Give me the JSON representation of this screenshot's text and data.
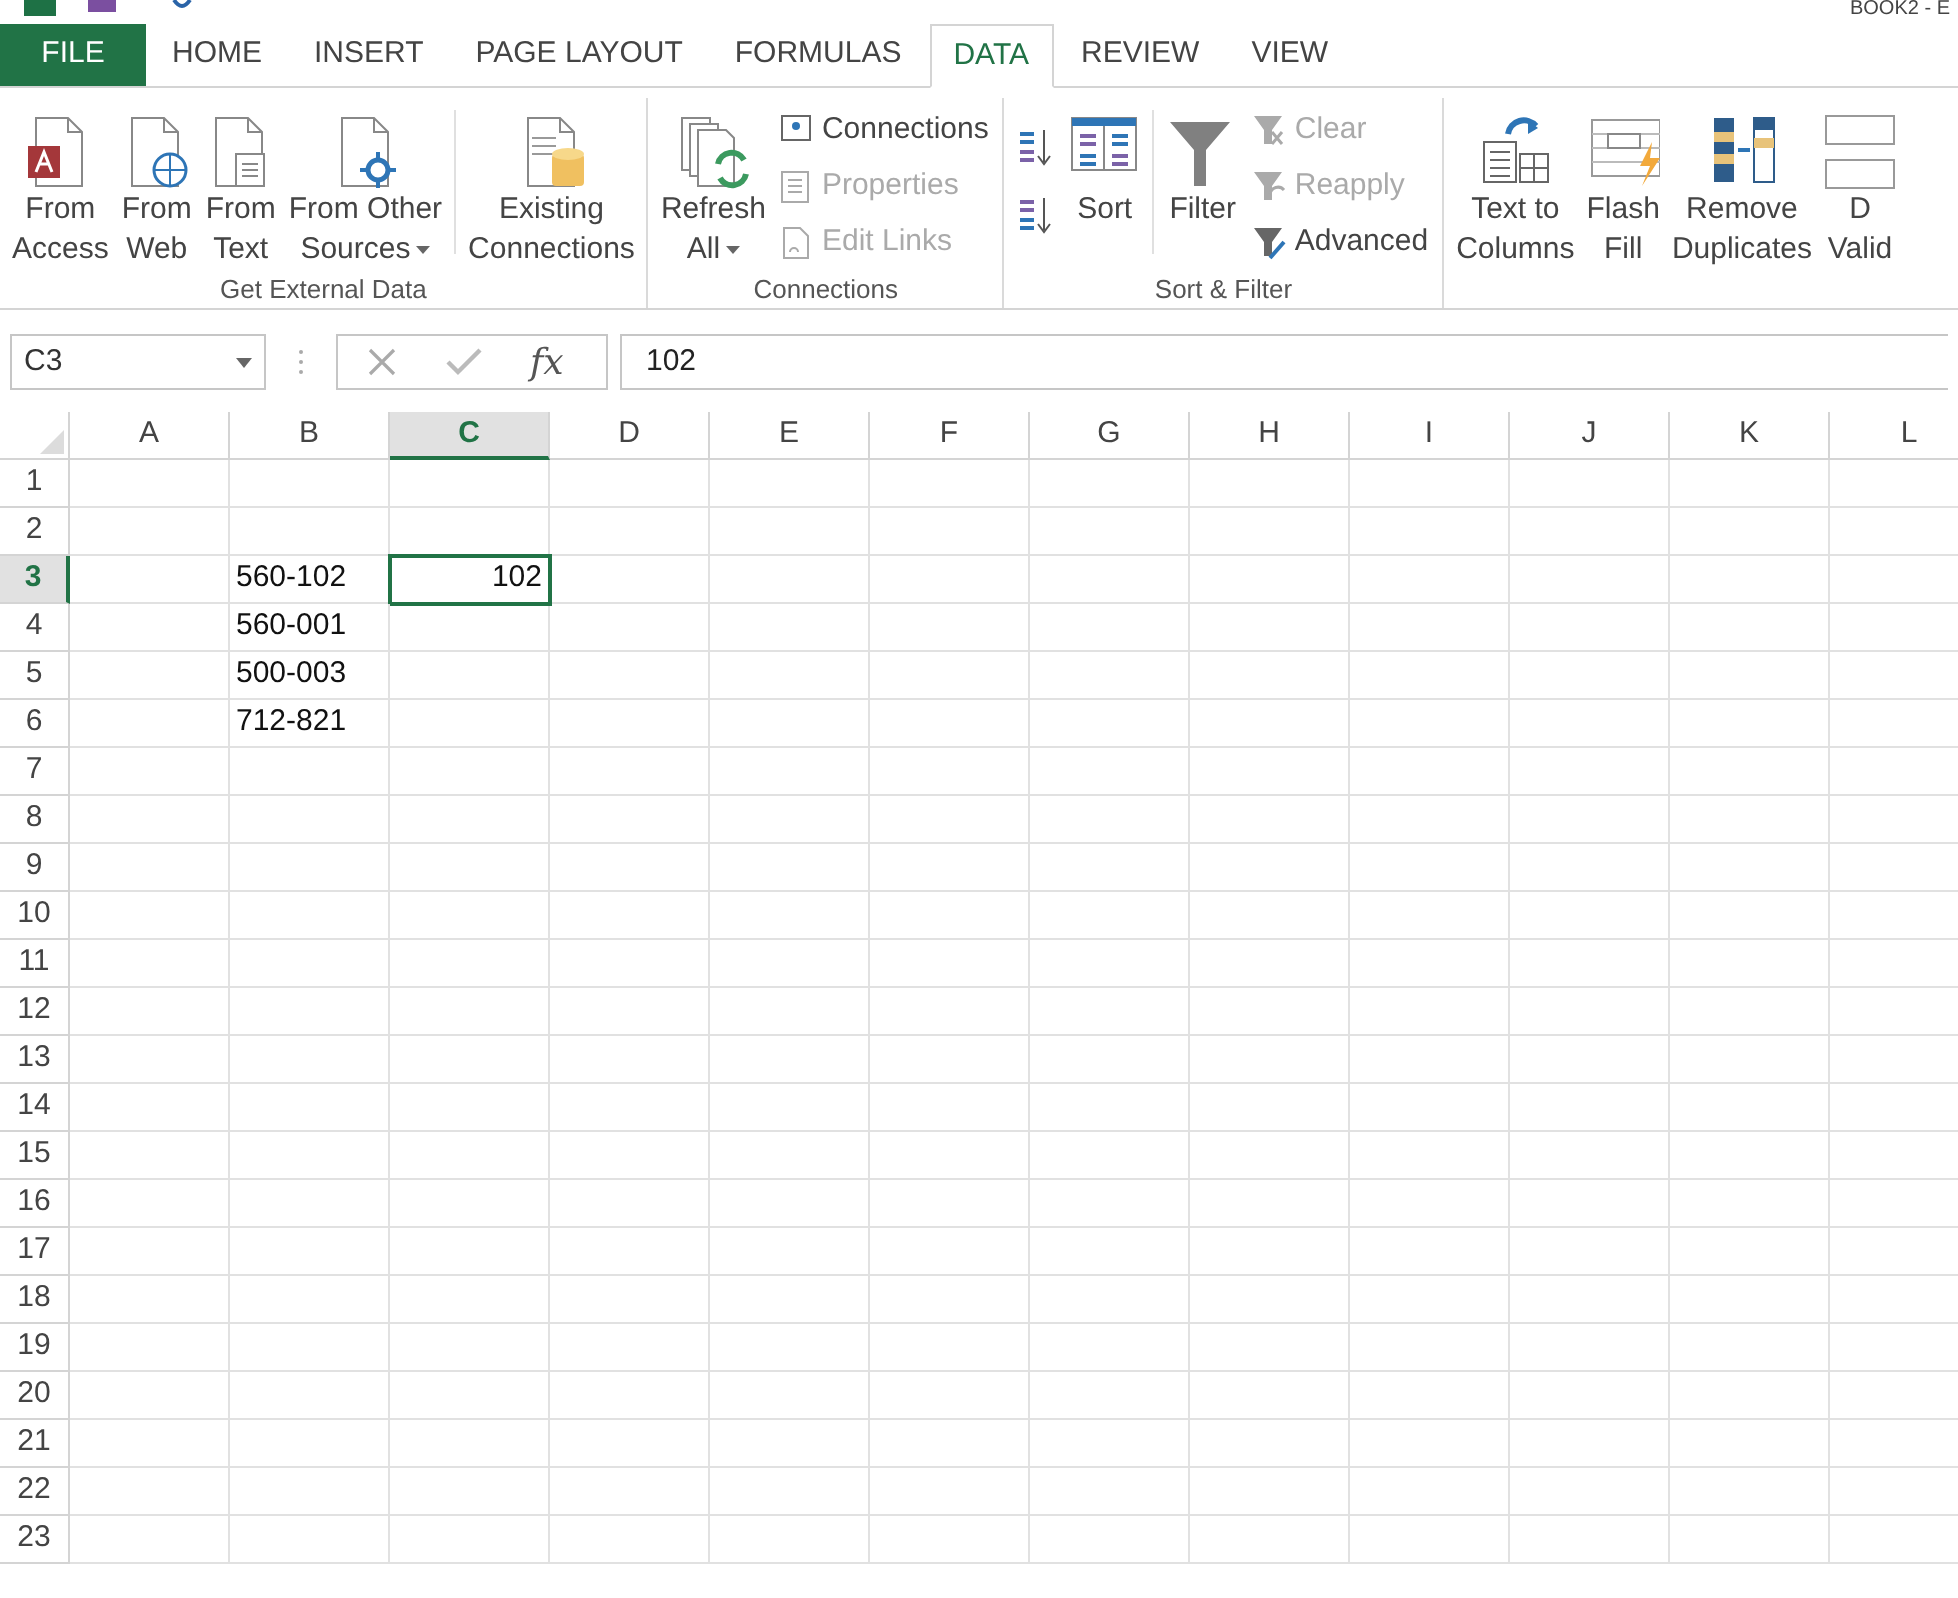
{
  "window": {
    "title": "BOOK2 - E"
  },
  "tabs": [
    {
      "label": "FILE",
      "kind": "file",
      "selected": false
    },
    {
      "label": "HOME",
      "kind": "tab",
      "selected": false
    },
    {
      "label": "INSERT",
      "kind": "tab",
      "selected": false
    },
    {
      "label": "PAGE LAYOUT",
      "kind": "tab",
      "selected": false
    },
    {
      "label": "FORMULAS",
      "kind": "tab",
      "selected": false
    },
    {
      "label": "DATA",
      "kind": "tab",
      "selected": true
    },
    {
      "label": "REVIEW",
      "kind": "tab",
      "selected": false
    },
    {
      "label": "VIEW",
      "kind": "tab",
      "selected": false
    }
  ],
  "ribbon": {
    "groups": [
      {
        "label": "Get External Data",
        "items": [
          {
            "kind": "large",
            "lines": [
              "From",
              "Access"
            ],
            "dropdown": false
          },
          {
            "kind": "large",
            "lines": [
              "From",
              "Web"
            ],
            "dropdown": false
          },
          {
            "kind": "large",
            "lines": [
              "From",
              "Text"
            ],
            "dropdown": false
          },
          {
            "kind": "large",
            "lines": [
              "From Other",
              "Sources"
            ],
            "dropdown": true
          },
          {
            "kind": "separator"
          },
          {
            "kind": "large",
            "lines": [
              "Existing",
              "Connections"
            ],
            "dropdown": false
          }
        ]
      },
      {
        "label": "Connections",
        "items": [
          {
            "kind": "large",
            "lines": [
              "Refresh",
              "All"
            ],
            "dropdown": true
          },
          {
            "kind": "stack",
            "entries": [
              {
                "label": "Connections",
                "disabled": false
              },
              {
                "label": "Properties",
                "disabled": true
              },
              {
                "label": "Edit Links",
                "disabled": true
              }
            ]
          }
        ]
      },
      {
        "label": "Sort & Filter",
        "items": [
          {
            "kind": "sortpair"
          },
          {
            "kind": "large",
            "lines": [
              "Sort"
            ],
            "dropdown": false
          },
          {
            "kind": "separator"
          },
          {
            "kind": "large",
            "lines": [
              "Filter"
            ],
            "dropdown": false
          },
          {
            "kind": "stack",
            "entries": [
              {
                "label": "Clear",
                "disabled": true
              },
              {
                "label": "Reapply",
                "disabled": true
              },
              {
                "label": "Advanced",
                "disabled": false
              }
            ]
          }
        ]
      },
      {
        "items": [
          {
            "kind": "large",
            "lines": [
              "Text to",
              "Columns"
            ],
            "dropdown": false
          },
          {
            "kind": "large",
            "lines": [
              "Flash",
              "Fill"
            ],
            "dropdown": false
          },
          {
            "kind": "large",
            "lines": [
              "Remove",
              "Duplicates"
            ],
            "dropdown": false
          },
          {
            "kind": "large",
            "lines": [
              "D",
              "Valid"
            ],
            "dropdown": false
          }
        ]
      }
    ]
  },
  "formula_bar": {
    "name_box": "C3",
    "function_label": "fx",
    "value": "102"
  },
  "sheet": {
    "columns": [
      {
        "label": "A",
        "selected": false
      },
      {
        "label": "B",
        "selected": false
      },
      {
        "label": "C",
        "selected": true
      },
      {
        "label": "D",
        "selected": false
      },
      {
        "label": "E",
        "selected": false
      },
      {
        "label": "F",
        "selected": false
      },
      {
        "label": "G",
        "selected": false
      },
      {
        "label": "H",
        "selected": false
      },
      {
        "label": "I",
        "selected": false
      },
      {
        "label": "J",
        "selected": false
      },
      {
        "label": "K",
        "selected": false
      },
      {
        "label": "L",
        "selected": false
      }
    ],
    "rows": [
      {
        "label": "1",
        "selected": false,
        "cells": []
      },
      {
        "label": "2",
        "selected": false,
        "cells": []
      },
      {
        "label": "3",
        "selected": true,
        "cells": [
          "",
          {
            "value": "560-102",
            "kind": "text",
            "selected": false
          },
          {
            "value": "102",
            "kind": "number",
            "selected": true
          }
        ]
      },
      {
        "label": "4",
        "selected": false,
        "cells": [
          "",
          {
            "value": "560-001",
            "kind": "text",
            "selected": false
          }
        ]
      },
      {
        "label": "5",
        "selected": false,
        "cells": [
          "",
          {
            "value": "500-003",
            "kind": "text",
            "selected": false
          }
        ]
      },
      {
        "label": "6",
        "selected": false,
        "cells": [
          "",
          {
            "value": "712-821",
            "kind": "text",
            "selected": false
          }
        ]
      },
      {
        "label": "7",
        "selected": false,
        "cells": []
      },
      {
        "label": "8",
        "selected": false,
        "cells": []
      },
      {
        "label": "9",
        "selected": false,
        "cells": []
      },
      {
        "label": "10",
        "selected": false,
        "cells": []
      },
      {
        "label": "11",
        "selected": false,
        "cells": []
      },
      {
        "label": "12",
        "selected": false,
        "cells": []
      },
      {
        "label": "13",
        "selected": false,
        "cells": []
      },
      {
        "label": "14",
        "selected": false,
        "cells": []
      },
      {
        "label": "15",
        "selected": false,
        "cells": []
      },
      {
        "label": "16",
        "selected": false,
        "cells": []
      },
      {
        "label": "17",
        "selected": false,
        "cells": []
      },
      {
        "label": "18",
        "selected": false,
        "cells": []
      },
      {
        "label": "19",
        "selected": false,
        "cells": []
      },
      {
        "label": "20",
        "selected": false,
        "cells": []
      },
      {
        "label": "21",
        "selected": false,
        "cells": []
      },
      {
        "label": "22",
        "selected": false,
        "cells": []
      },
      {
        "label": "23",
        "selected": false,
        "cells": []
      }
    ]
  }
}
